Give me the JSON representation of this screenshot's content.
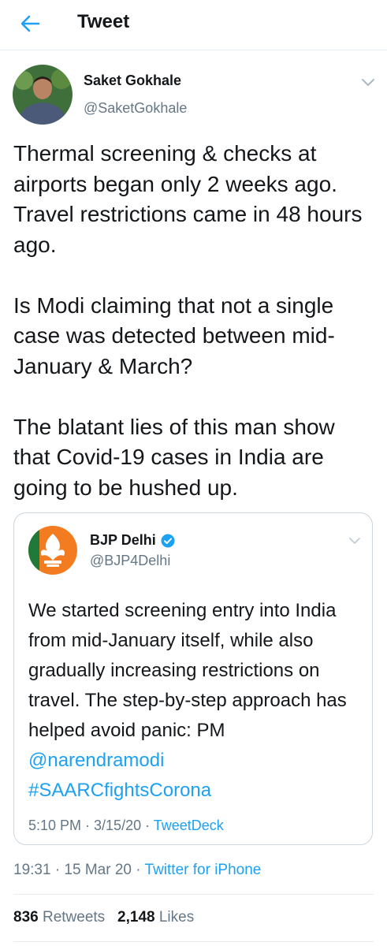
{
  "header": {
    "title": "Tweet"
  },
  "tweet": {
    "author_name": "Saket Gokhale",
    "author_handle": "@SaketGokhale",
    "paragraphs": [
      "Thermal screening & checks at airports began only 2 weeks ago. Travel restrictions came in 48 hours ago.",
      "Is Modi claiming that not a single case was detected between mid-January & March?",
      "The blatant lies of this man show that Covid-19 cases in India are going to be hushed up."
    ],
    "time": "19:31 · 15 Mar 20",
    "separator": " · ",
    "source": "Twitter for iPhone",
    "retweets_count": "836",
    "retweets_label": "Retweets",
    "likes_count": "2,148",
    "likes_label": "Likes"
  },
  "quoted": {
    "author_name": "BJP Delhi",
    "author_handle": "@BJP4Delhi",
    "text": "We started screening entry into India from mid-January itself, while also gradually increasing restrictions on travel. The step-by-step approach has helped avoid panic: PM",
    "mention": "@narendramodi",
    "hashtag": "#SAARCfightsCorona",
    "time": "5:10 PM · 3/15/20",
    "separator": " · ",
    "source": "TweetDeck"
  },
  "colors": {
    "link": "#1da1f2",
    "muted": "#657786",
    "bjp_orange": "#f47c20"
  },
  "icons": [
    "back-arrow-icon",
    "chevron-down-icon",
    "verified-badge-icon"
  ]
}
